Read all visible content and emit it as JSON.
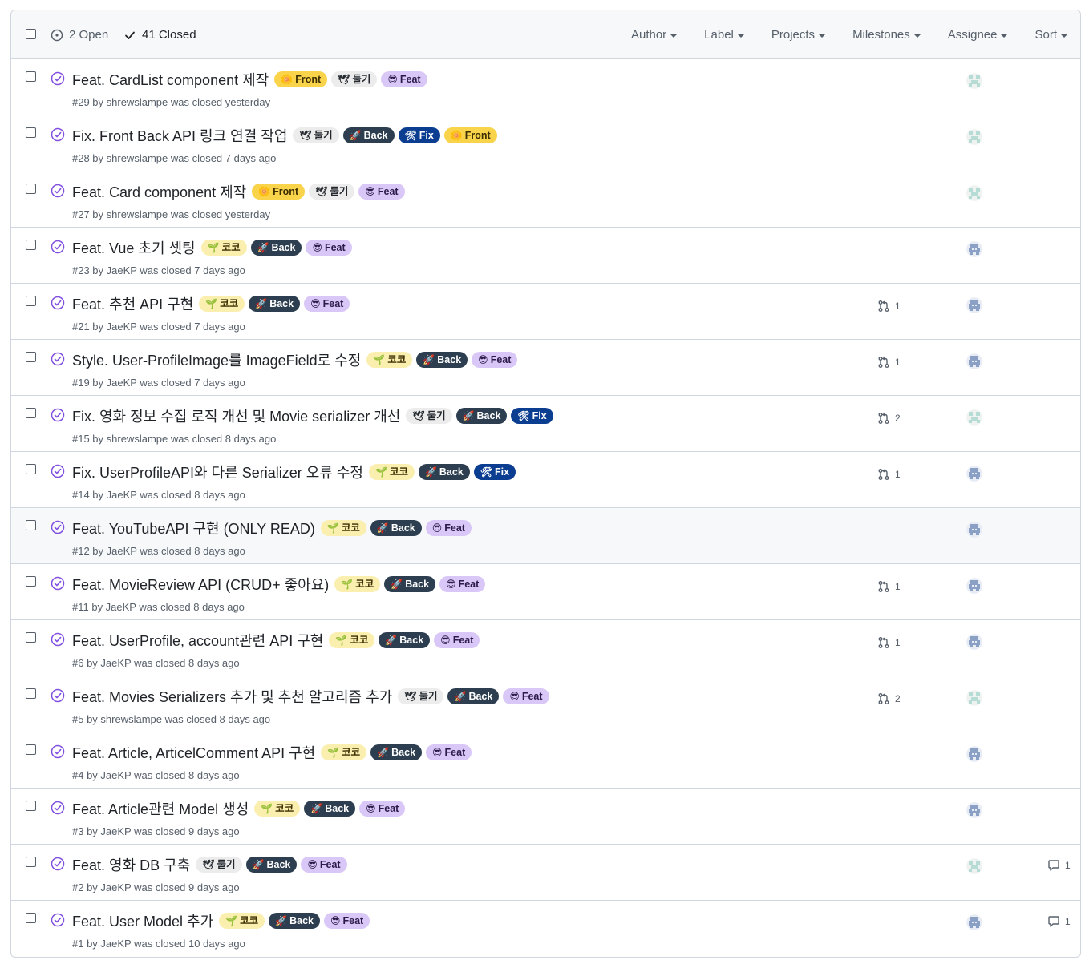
{
  "header": {
    "open_label": "2 Open",
    "closed_label": "41 Closed",
    "filters": [
      "Author",
      "Label",
      "Projects",
      "Milestones",
      "Assignee",
      "Sort"
    ]
  },
  "label_styles": {
    "Front": {
      "bg": "#f9d34a",
      "fg": "#3d2e00",
      "icon": "🌼"
    },
    "둘기": {
      "bg": "#ececec",
      "fg": "#24292f",
      "icon": "🕊"
    },
    "Feat": {
      "bg": "#d9c8f7",
      "fg": "#2b1a4a",
      "icon": "😎"
    },
    "Back": {
      "bg": "#2c3e50",
      "fg": "#ffffff",
      "icon": "🚀"
    },
    "Fix": {
      "bg": "#0b3d91",
      "fg": "#ffffff",
      "icon": "🛠"
    },
    "코코": {
      "bg": "#fbefb0",
      "fg": "#3d2e00",
      "icon": "🌱"
    }
  },
  "issues": [
    {
      "title": "Feat. CardList component 제작",
      "labels": [
        "Front",
        "둘기",
        "Feat"
      ],
      "meta": "#29 by shrewslampe was closed yesterday",
      "pr": null,
      "comments": null,
      "avatar": "light"
    },
    {
      "title": "Fix. Front Back API 링크 연결 작업",
      "labels": [
        "둘기",
        "Back",
        "Fix",
        "Front"
      ],
      "meta": "#28 by shrewslampe was closed 7 days ago",
      "pr": null,
      "comments": null,
      "avatar": "light"
    },
    {
      "title": "Feat. Card component 제작",
      "labels": [
        "Front",
        "둘기",
        "Feat"
      ],
      "meta": "#27 by shrewslampe was closed yesterday",
      "pr": null,
      "comments": null,
      "avatar": "light"
    },
    {
      "title": "Feat. Vue 초기 셋팅",
      "labels": [
        "코코",
        "Back",
        "Feat"
      ],
      "meta": "#23 by JaeKP was closed 7 days ago",
      "pr": null,
      "comments": null,
      "avatar": "dark"
    },
    {
      "title": "Feat. 추천 API 구현",
      "labels": [
        "코코",
        "Back",
        "Feat"
      ],
      "meta": "#21 by JaeKP was closed 7 days ago",
      "pr": "1",
      "comments": null,
      "avatar": "dark"
    },
    {
      "title": "Style. User-ProfileImage를 ImageField로 수정",
      "labels": [
        "코코",
        "Back",
        "Feat"
      ],
      "meta": "#19 by JaeKP was closed 7 days ago",
      "pr": "1",
      "comments": null,
      "avatar": "dark"
    },
    {
      "title": "Fix. 영화 정보 수집 로직 개선 및 Movie serializer 개선",
      "labels": [
        "둘기",
        "Back",
        "Fix"
      ],
      "meta": "#15 by shrewslampe was closed 8 days ago",
      "pr": "2",
      "comments": null,
      "avatar": "light"
    },
    {
      "title": "Fix. UserProfileAPI와 다른 Serializer 오류 수정",
      "labels": [
        "코코",
        "Back",
        "Fix"
      ],
      "meta": "#14 by JaeKP was closed 8 days ago",
      "pr": "1",
      "comments": null,
      "avatar": "dark"
    },
    {
      "title": "Feat. YouTubeAPI 구현 (ONLY READ)",
      "labels": [
        "코코",
        "Back",
        "Feat"
      ],
      "meta": "#12 by JaeKP was closed 8 days ago",
      "pr": null,
      "comments": null,
      "avatar": "dark"
    },
    {
      "title": "Feat. MovieReview API (CRUD+ 좋아요)",
      "labels": [
        "코코",
        "Back",
        "Feat"
      ],
      "meta": "#11 by JaeKP was closed 8 days ago",
      "pr": "1",
      "comments": null,
      "avatar": "dark"
    },
    {
      "title": "Feat. UserProfile, account관련 API 구현",
      "labels": [
        "코코",
        "Back",
        "Feat"
      ],
      "meta": "#6 by JaeKP was closed 8 days ago",
      "pr": "1",
      "comments": null,
      "avatar": "dark"
    },
    {
      "title": "Feat. Movies Serializers 추가 및 추천 알고리즘 추가",
      "labels": [
        "둘기",
        "Back",
        "Feat"
      ],
      "meta": "#5 by shrewslampe was closed 8 days ago",
      "pr": "2",
      "comments": null,
      "avatar": "light"
    },
    {
      "title": "Feat. Article, ArticelComment API 구현",
      "labels": [
        "코코",
        "Back",
        "Feat"
      ],
      "meta": "#4 by JaeKP was closed 8 days ago",
      "pr": null,
      "comments": null,
      "avatar": "dark"
    },
    {
      "title": "Feat. Article관련 Model 생성",
      "labels": [
        "코코",
        "Back",
        "Feat"
      ],
      "meta": "#3 by JaeKP was closed 9 days ago",
      "pr": null,
      "comments": null,
      "avatar": "dark"
    },
    {
      "title": "Feat. 영화 DB 구축",
      "labels": [
        "둘기",
        "Back",
        "Feat"
      ],
      "meta": "#2 by JaeKP was closed 9 days ago",
      "pr": null,
      "comments": "1",
      "avatar": "light"
    },
    {
      "title": "Feat. User Model 추가",
      "labels": [
        "코코",
        "Back",
        "Feat"
      ],
      "meta": "#1 by JaeKP was closed 10 days ago",
      "pr": null,
      "comments": "1",
      "avatar": "dark"
    }
  ]
}
